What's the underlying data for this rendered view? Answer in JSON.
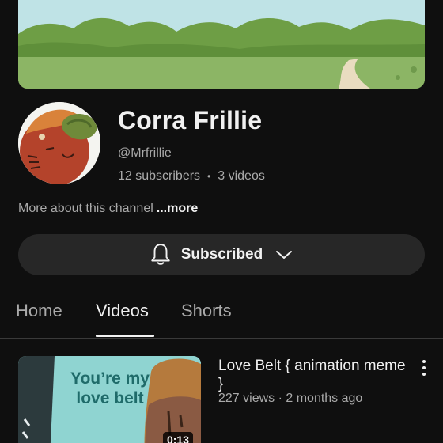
{
  "channel": {
    "name": "Corra Frillie",
    "handle": "@Mrfrillie",
    "subscribers": "12 subscribers",
    "separator": "•",
    "videos": "3 videos",
    "about_text": "More about this channel",
    "about_more": "...more"
  },
  "subscribe_button": {
    "label": "Subscribed",
    "icon": "bell-icon",
    "dropdown_icon": "chevron-down-icon"
  },
  "tabs": [
    {
      "label": "Home",
      "active": false
    },
    {
      "label": "Videos",
      "active": true
    },
    {
      "label": "Shorts",
      "active": false
    }
  ],
  "videos": [
    {
      "title": "Love Belt { animation meme }",
      "meta": "227 views · 2 months ago",
      "duration": "0:13",
      "thumbnail_text": "You’re my love belt"
    }
  ],
  "colors": {
    "background": "#0f0f0f",
    "button_bg": "#272727",
    "primary_text": "#f1f1f1",
    "secondary_text": "#aaaaaa",
    "thumbnail_bg": "#8fd4d1"
  }
}
